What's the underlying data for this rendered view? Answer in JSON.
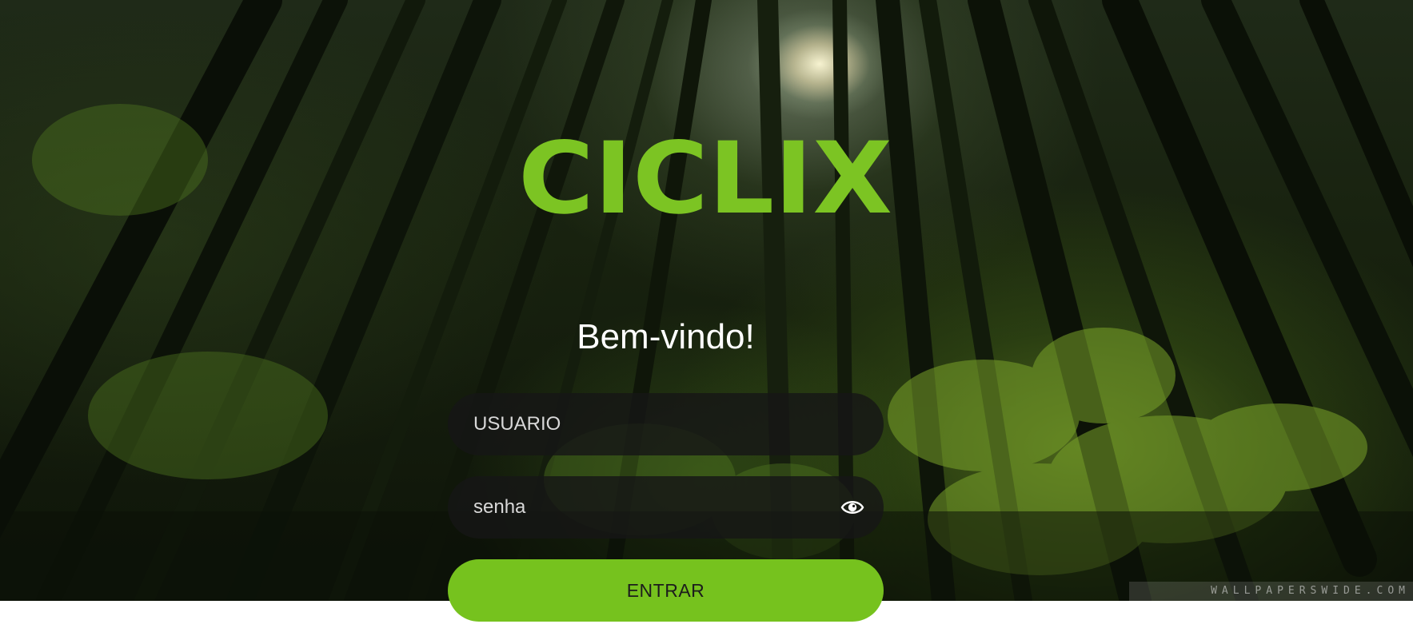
{
  "brand": {
    "name": "CICLIX",
    "color": "#7cc423"
  },
  "login": {
    "welcome": "Bem-vindo!",
    "username_placeholder": "USUARIO",
    "password_placeholder": "senha",
    "submit_label": "ENTRAR",
    "accent_color": "#76c21e"
  },
  "icons": {
    "password_toggle": "eye-icon"
  },
  "background": {
    "watermark": "WALLPAPERSWIDE.COM"
  }
}
